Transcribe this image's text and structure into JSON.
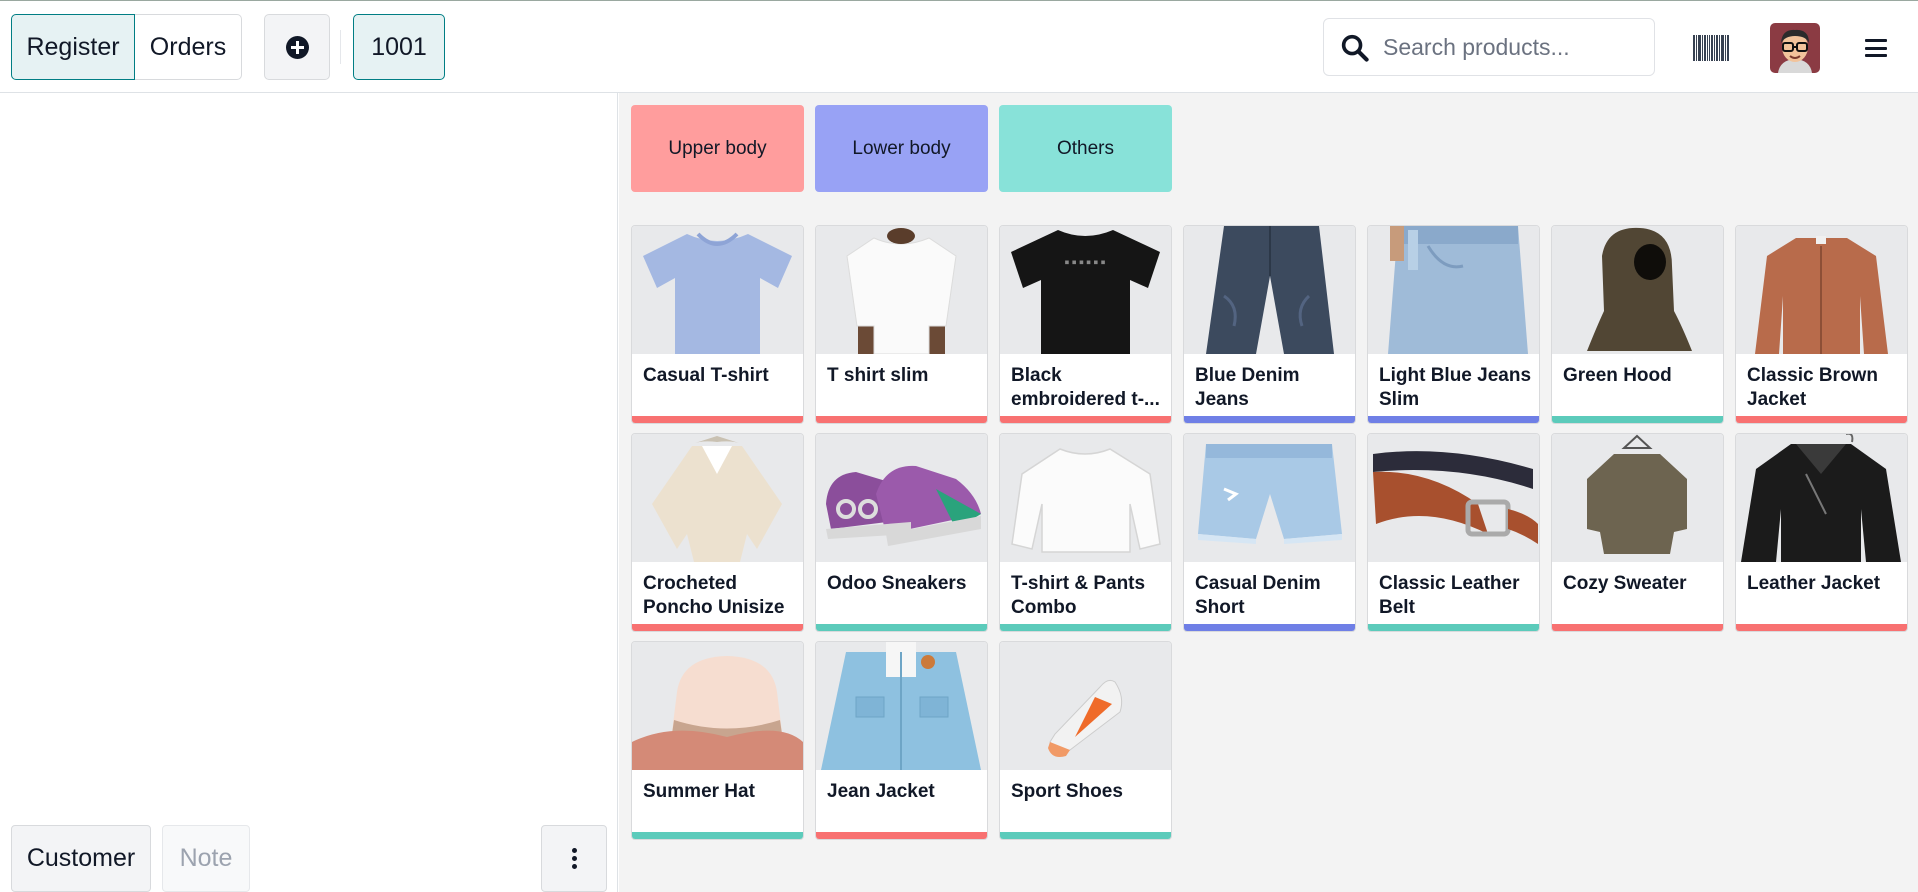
{
  "topbar": {
    "register_label": "Register",
    "orders_label": "Orders",
    "order_number": "1001",
    "search_placeholder": "Search products..."
  },
  "left": {
    "customer_label": "Customer",
    "note_label": "Note"
  },
  "colors": {
    "upper": "#f87171",
    "lower": "#6f7fe6",
    "others": "#5ccbbb",
    "accent": "#017e84"
  },
  "categories": [
    {
      "label": "Upper body",
      "color": "#ff9d9d"
    },
    {
      "label": "Lower body",
      "color": "#98a2f5"
    },
    {
      "label": "Others",
      "color": "#88e2d9"
    }
  ],
  "products": [
    {
      "name": "Casual T-shirt",
      "cat": "upper",
      "icon": "tshirt-blue-icon"
    },
    {
      "name": "T shirt slim",
      "cat": "upper",
      "icon": "tshirt-white-icon"
    },
    {
      "name": "Black embroidered t-...",
      "cat": "upper",
      "icon": "tshirt-black-icon"
    },
    {
      "name": "Blue Denim Jeans",
      "cat": "lower",
      "icon": "jeans-dark-icon"
    },
    {
      "name": "Light Blue Jeans Slim",
      "cat": "lower",
      "icon": "jeans-light-icon"
    },
    {
      "name": "Green Hood",
      "cat": "others",
      "icon": "balaclava-icon"
    },
    {
      "name": "Classic Brown Jacket",
      "cat": "upper",
      "icon": "jacket-brown-icon"
    },
    {
      "name": "Crocheted Poncho Unisize",
      "cat": "upper",
      "icon": "poncho-icon"
    },
    {
      "name": "Odoo Sneakers",
      "cat": "others",
      "icon": "sneakers-icon"
    },
    {
      "name": "T-shirt & Pants Combo",
      "cat": "others",
      "icon": "sweatshirt-white-icon"
    },
    {
      "name": "Casual Denim Short",
      "cat": "lower",
      "icon": "denim-short-icon"
    },
    {
      "name": "Classic Leather Belt",
      "cat": "others",
      "icon": "belt-icon"
    },
    {
      "name": "Cozy Sweater",
      "cat": "upper",
      "icon": "sweater-icon"
    },
    {
      "name": "Leather Jacket",
      "cat": "upper",
      "icon": "leather-jacket-icon"
    },
    {
      "name": "Summer Hat",
      "cat": "others",
      "icon": "hat-icon"
    },
    {
      "name": "Jean Jacket",
      "cat": "upper",
      "icon": "jean-jacket-icon"
    },
    {
      "name": "Sport Shoes",
      "cat": "others",
      "icon": "sport-shoe-icon"
    }
  ]
}
